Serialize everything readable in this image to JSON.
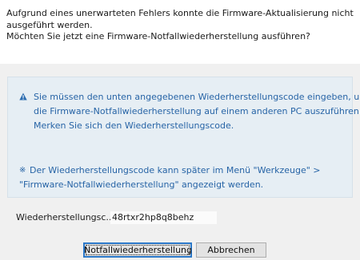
{
  "message": {
    "line1": "Aufgrund eines unerwarteten Fehlers konnte die Firmware-Aktualisierung nicht",
    "line2": "ausgeführt werden.",
    "line3": "Möchten Sie jetzt eine Firmware-Notfallwiederherstellung ausführen?"
  },
  "info": {
    "warning_lines": [
      "Sie müssen den unten angegebenen Wiederherstellungscode eingeben, um",
      "die Firmware-Notfallwiederherstellung auf einem anderen PC auszuführen.",
      "Merken Sie sich den Wiederherstellungscode."
    ],
    "note_icon": "※",
    "note_lines": [
      "Der Wiederherstellungscode kann später im Menü \"Werkzeuge\" >",
      "\"Firmware-Notfallwiederherstellung\" angezeigt werden."
    ],
    "warning_icon": "warning-icon",
    "text_color": "#2764a6"
  },
  "code": {
    "label": "Wiederherstellungsc...",
    "value": "48rtxr2hp8q8behz"
  },
  "buttons": {
    "primary_label": "Notfallwiederherstellung",
    "secondary_label": "Abbrechen"
  }
}
